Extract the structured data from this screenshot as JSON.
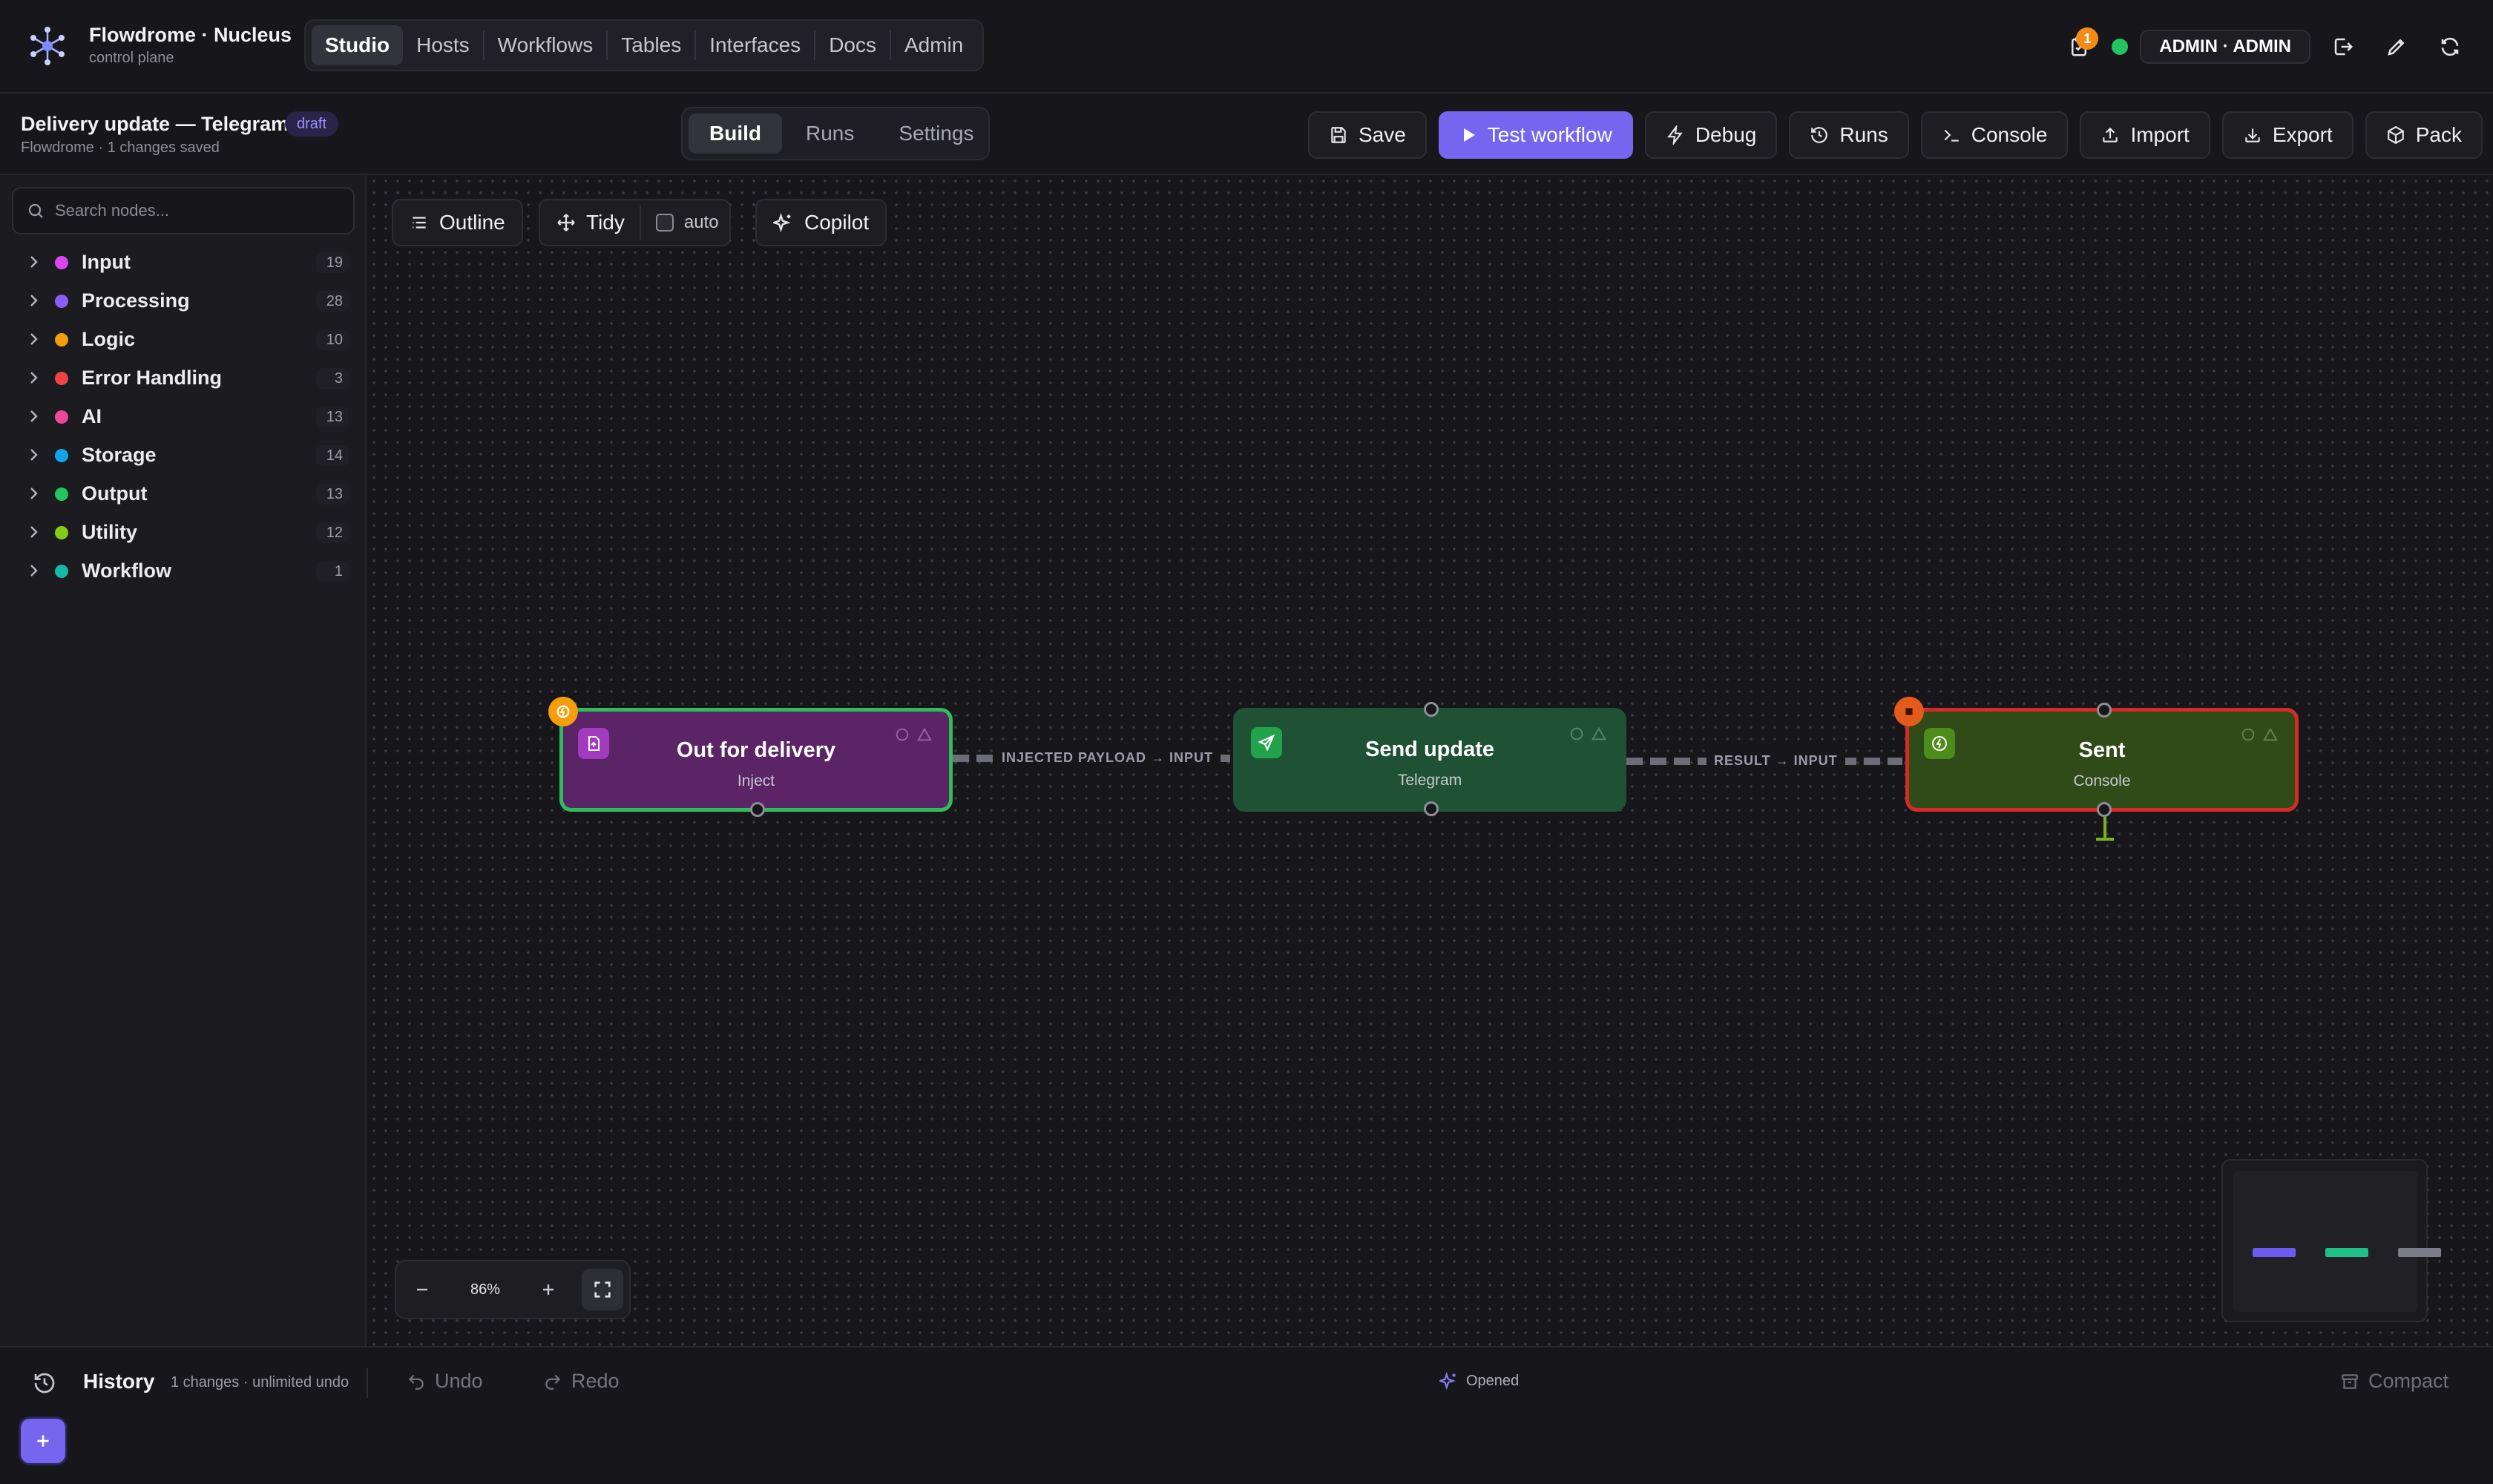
{
  "app": {
    "title": "Flowdrome · Nucleus",
    "subtitle": "control plane"
  },
  "nav": [
    {
      "label": "Studio",
      "active": true
    },
    {
      "label": "Hosts"
    },
    {
      "label": "Workflows"
    },
    {
      "label": "Tables"
    },
    {
      "label": "Interfaces"
    },
    {
      "label": "Docs"
    },
    {
      "label": "Admin"
    }
  ],
  "topright": {
    "notif_count": "1",
    "status_color": "#22c55e",
    "user": "ADMIN · ADMIN",
    "icons": [
      "clipboard-icon",
      "logout-icon",
      "pencil-icon",
      "refresh-icon"
    ]
  },
  "workflow": {
    "title": "Delivery update — Telegram",
    "status": "draft",
    "subtitle": "Flowdrome · 1 changes saved"
  },
  "modes": [
    {
      "label": "Build",
      "active": true
    },
    {
      "label": "Runs"
    },
    {
      "label": "Settings"
    }
  ],
  "actions": {
    "save": "Save",
    "test": "Test workflow",
    "debug": "Debug",
    "runs": "Runs",
    "console": "Console",
    "import": "Import",
    "export": "Export",
    "pack": "Pack"
  },
  "sidebar": {
    "search_placeholder": "Search nodes...",
    "categories": [
      {
        "label": "Input",
        "count": "19",
        "color": "#d946ef"
      },
      {
        "label": "Processing",
        "count": "28",
        "color": "#8b5cf6"
      },
      {
        "label": "Logic",
        "count": "10",
        "color": "#f59e0b"
      },
      {
        "label": "Error Handling",
        "count": "3",
        "color": "#ef4444"
      },
      {
        "label": "AI",
        "count": "13",
        "color": "#ec4899"
      },
      {
        "label": "Storage",
        "count": "14",
        "color": "#0ea5e9"
      },
      {
        "label": "Output",
        "count": "13",
        "color": "#22c55e"
      },
      {
        "label": "Utility",
        "count": "12",
        "color": "#84cc16"
      },
      {
        "label": "Workflow",
        "count": "1",
        "color": "#14b8a6"
      }
    ]
  },
  "canvas_tools": {
    "outline": "Outline",
    "tidy": "Tidy",
    "auto": "auto",
    "copilot": "Copilot"
  },
  "nodes": [
    {
      "title": "Out for delivery",
      "subtitle": "Inject",
      "fill": "#5b2467",
      "border": "#2dbd5a"
    },
    {
      "title": "Send update",
      "subtitle": "Telegram",
      "fill": "#1f5234",
      "border": "#1f5234"
    },
    {
      "title": "Sent",
      "subtitle": "Console",
      "fill": "#304b18",
      "border": "#d52a26"
    }
  ],
  "edges": [
    {
      "label": "INJECTED PAYLOAD → INPUT"
    },
    {
      "label": "RESULT → INPUT"
    }
  ],
  "zoom": {
    "value": "86%"
  },
  "history": {
    "title": "History",
    "subtitle": "1 changes · unlimited undo",
    "undo": "Undo",
    "redo": "Redo",
    "status": "Opened",
    "compact": "Compact"
  }
}
